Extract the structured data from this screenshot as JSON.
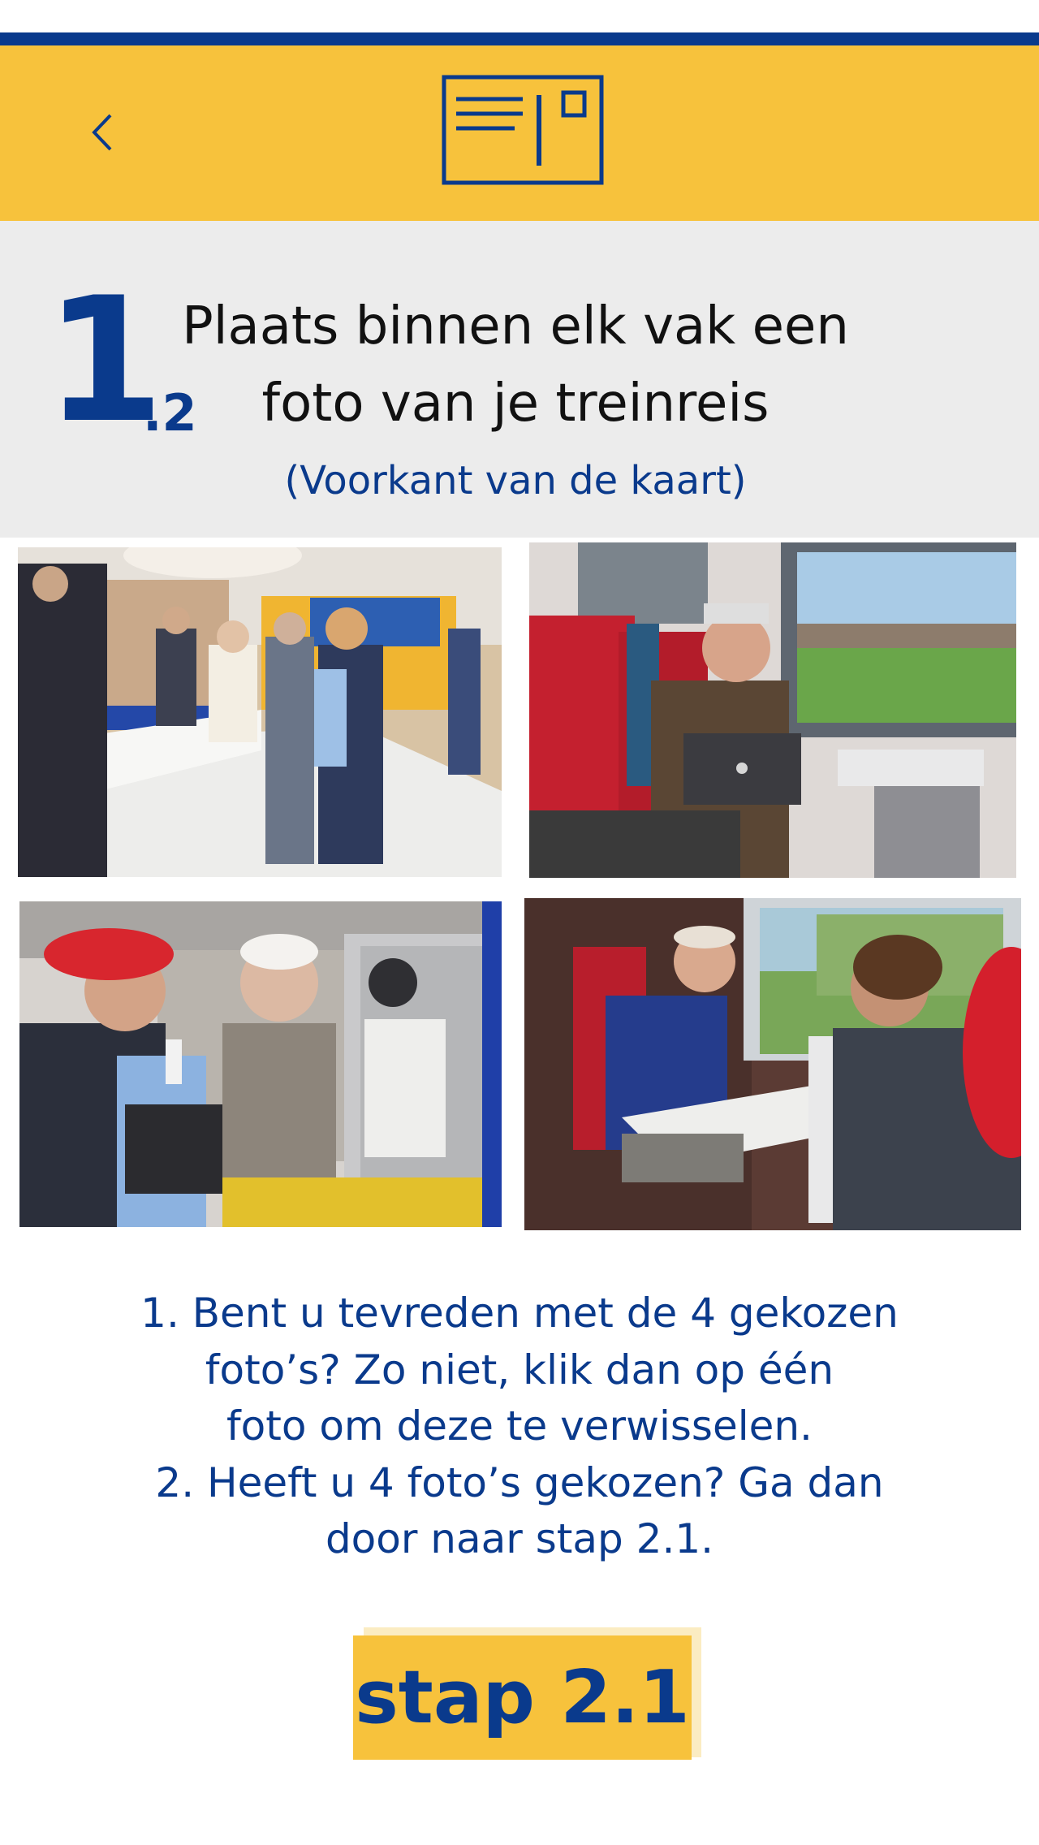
{
  "header": {
    "back_icon": "chevron-left-icon",
    "logo_icon": "postcard-icon",
    "colors": {
      "accent": "#f7c23c",
      "brand": "#0a3a8c",
      "panel": "#ececec"
    }
  },
  "step": {
    "number": "1",
    "sub": ".2",
    "title_line1": "Plaats binnen elk vak een",
    "title_line2": "foto van je treinreis",
    "subtitle": "(Voorkant van de kaart)"
  },
  "photos": [
    {
      "icon": "photo-station-service-desk"
    },
    {
      "icon": "photo-man-laptop-train"
    },
    {
      "icon": "photo-ticket-counter"
    },
    {
      "icon": "photo-couple-reading-train"
    }
  ],
  "instructions": {
    "line1": "1. Bent u tevreden met de 4 gekozen",
    "line2": "foto’s? Zo niet, klik dan op één",
    "line3": "foto om deze te verwisselen.",
    "line4": "2. Heeft u 4 foto’s gekozen? Ga dan",
    "line5": "door naar stap 2.1."
  },
  "next_button": {
    "label": "stap 2.1"
  }
}
